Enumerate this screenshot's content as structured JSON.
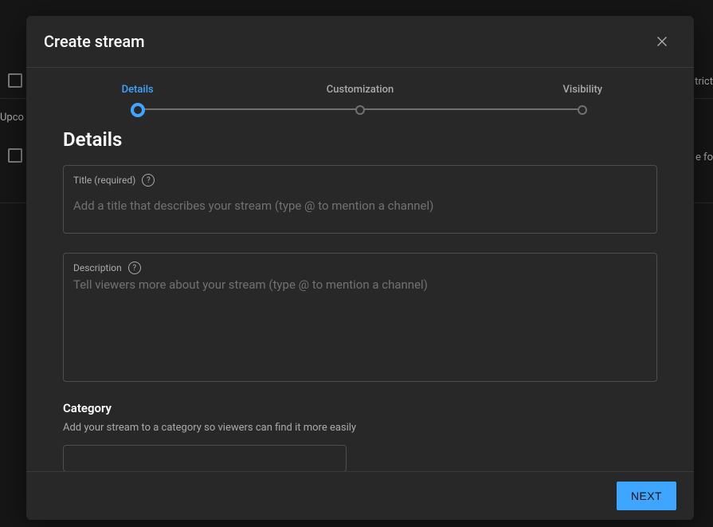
{
  "background": {
    "upcoming_label": "Upco",
    "right_text1": "trict",
    "right_text2": "e fo"
  },
  "modal": {
    "title": "Create stream",
    "stepper": {
      "step1": "Details",
      "step2": "Customization",
      "step3": "Visibility"
    },
    "details": {
      "heading": "Details",
      "title_field": {
        "label": "Title (required)",
        "placeholder": "Add a title that describes your stream (type @ to mention a channel)"
      },
      "description_field": {
        "label": "Description",
        "placeholder": "Tell viewers more about your stream (type @ to mention a channel)"
      },
      "category": {
        "heading": "Category",
        "description": "Add your stream to a category so viewers can find it more easily"
      }
    },
    "footer": {
      "next": "NEXT"
    }
  }
}
